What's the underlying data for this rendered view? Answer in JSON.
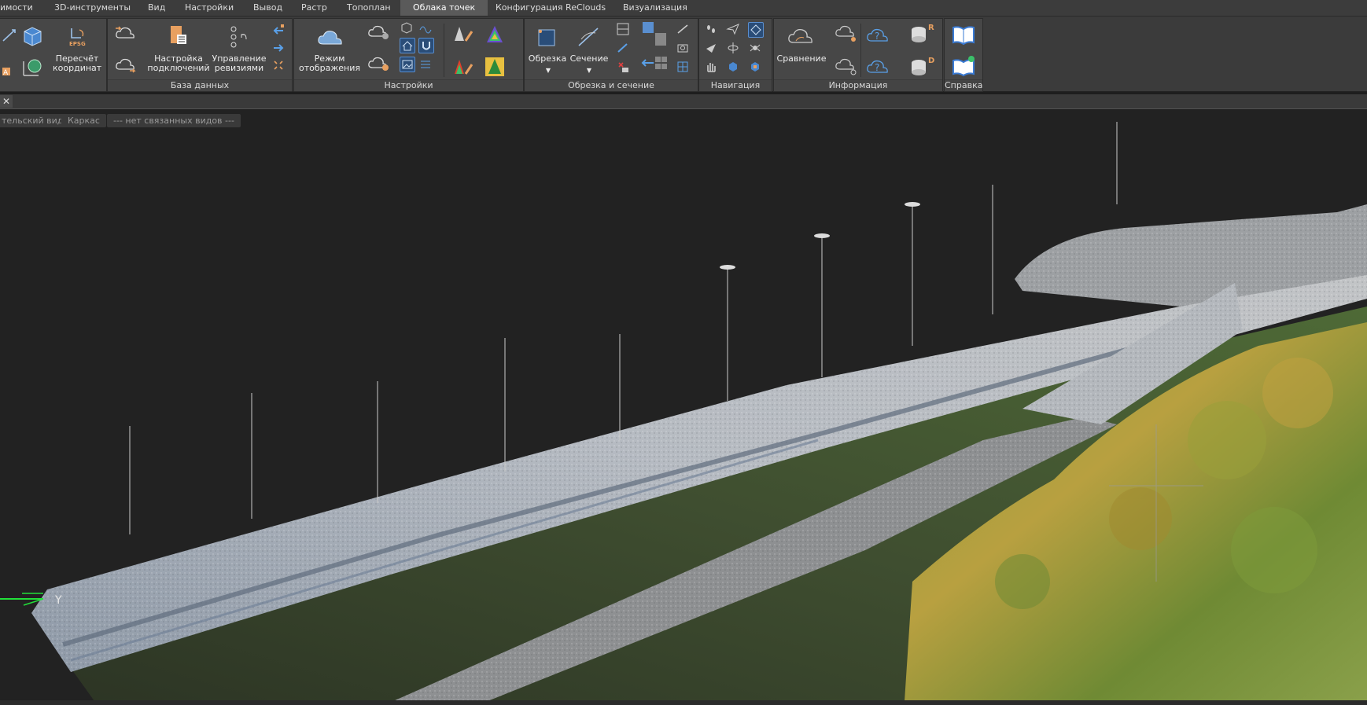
{
  "menu": {
    "tabs": [
      "имости",
      "3D-инструменты",
      "Вид",
      "Настройки",
      "Вывод",
      "Растр",
      "Топоплан",
      "Облака точек",
      "Конфигурация ReClouds",
      "Визуализация"
    ],
    "active": "Облака точек"
  },
  "ribbon": {
    "first": {
      "reproject_label": "Пересчёт координат",
      "epsg_label": "EPSG"
    },
    "db": {
      "title": "База данных",
      "connections_label": "Настройка подключений",
      "revisions_label": "Управление ревизиями"
    },
    "settings": {
      "title": "Настройки",
      "display_mode_label": "Режим отображения"
    },
    "clip": {
      "title": "Обрезка и сечение",
      "clip_label": "Обрезка",
      "section_label": "Сечение"
    },
    "nav": {
      "title": "Навигация"
    },
    "info": {
      "title": "Информация",
      "compare_label": "Сравнение",
      "r_badge": "R",
      "d_badge": "D"
    },
    "help": {
      "title": "Справка"
    }
  },
  "viewtabs": [
    "тельский вид",
    "Каркас",
    "--- нет связанных видов ---"
  ],
  "viewport": {
    "axis_label": "Y"
  },
  "colors": {
    "accent": "#5a8fd0",
    "background": "#1e1e1e",
    "ribbon": "#474747",
    "axis_y": "#22e03a"
  }
}
